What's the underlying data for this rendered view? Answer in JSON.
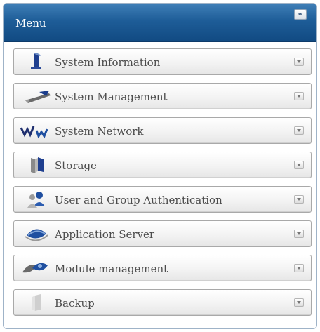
{
  "header": {
    "title": "Menu",
    "collapse_label": "«"
  },
  "menu": {
    "items": [
      {
        "label": "System Information",
        "icon": "system-information-icon"
      },
      {
        "label": "System Management",
        "icon": "system-management-icon"
      },
      {
        "label": "System Network",
        "icon": "system-network-icon"
      },
      {
        "label": "Storage",
        "icon": "storage-icon"
      },
      {
        "label": "User and Group Authentication",
        "icon": "user-group-icon"
      },
      {
        "label": "Application Server",
        "icon": "application-server-icon"
      },
      {
        "label": "Module management",
        "icon": "module-management-icon"
      },
      {
        "label": "Backup",
        "icon": "backup-icon"
      }
    ]
  },
  "colors": {
    "header": "#1e5d98",
    "item_text": "#4c4c4c",
    "item_border": "#a9a9a9"
  }
}
